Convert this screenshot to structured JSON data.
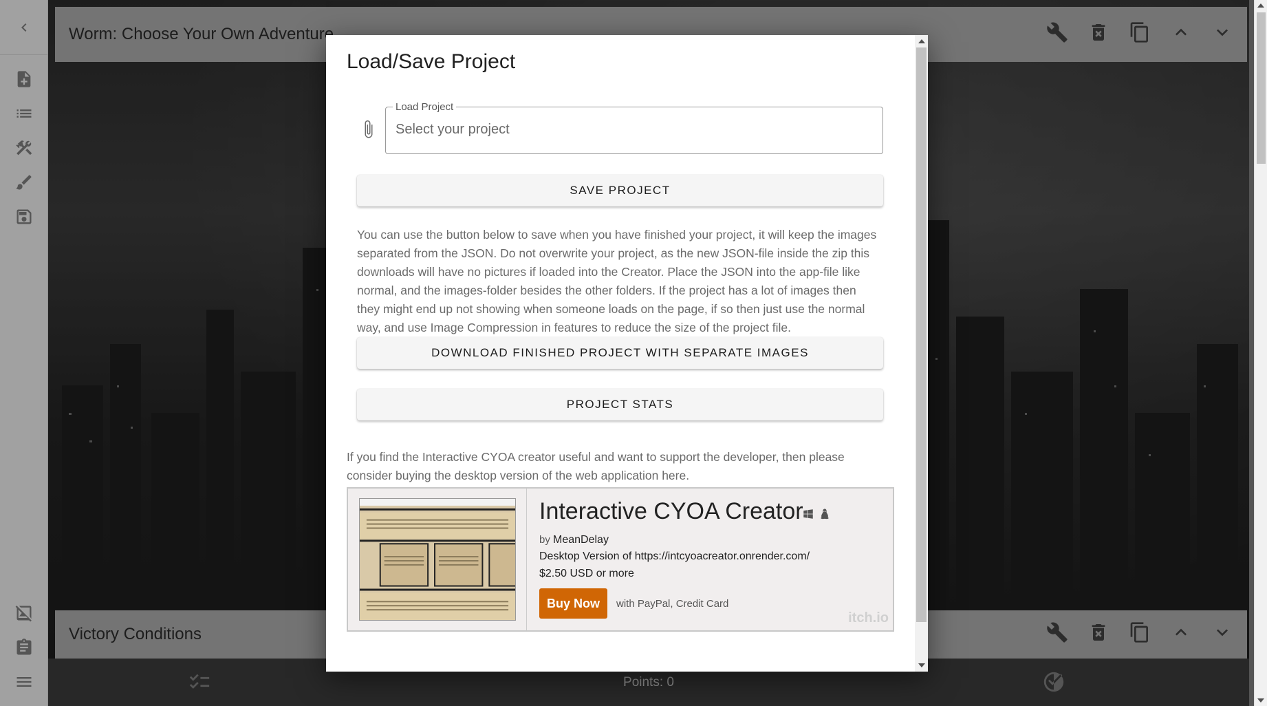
{
  "rail": {
    "icons": [
      "chevron-left-icon",
      "new-file-icon",
      "list-icon",
      "tools-icon",
      "brush-icon",
      "save-icon",
      "no-image-icon",
      "clipboard-icon",
      "menu-icon"
    ]
  },
  "rows": {
    "top": {
      "title": "Worm: Choose Your Own Adventure"
    },
    "bottom": {
      "title": "Victory Conditions"
    }
  },
  "footer": {
    "points": "Points: 0"
  },
  "modal": {
    "title": "Load/Save Project",
    "load_label": "Load Project",
    "load_placeholder": "Select your project",
    "save_button": "SAVE PROJECT",
    "info_text": "You can use the button below to save when you have finished your project, it will keep the images separated from the JSON. Do not overwrite your project, as the new JSON-file inside the zip this downloads will have no pictures if loaded into the Creator. Place the JSON into the app-file like normal, and the images-folder besides the other folders. If the project has a lot of images then they might end up not showing when someone loads on the page, if so then just use the normal way, and use Image Compression in features to reduce the size of the project file.",
    "download_button": "DOWNLOAD FINISHED PROJECT WITH SEPARATE IMAGES",
    "stats_button": "PROJECT STATS",
    "support_text": "If you find the Interactive CYOA creator useful and want to support the developer, then please consider buying the desktop version of the web application here."
  },
  "itch": {
    "name": "Interactive CYOA Creator",
    "by_prefix": "by",
    "author": "MeanDelay",
    "description": "Desktop Version of https://intcyoacreator.onrender.com/",
    "price": "$2.50 USD",
    "price_suffix": "or more",
    "buy_label": "Buy Now",
    "payment": "with PayPal, Credit Card",
    "logo": "itch.io"
  },
  "colors": {
    "buy_button": "#d06605",
    "rail_bg": "#e7e7e7",
    "row_bg": "#a6a6a6",
    "footer_bg": "#3a3a3a"
  }
}
